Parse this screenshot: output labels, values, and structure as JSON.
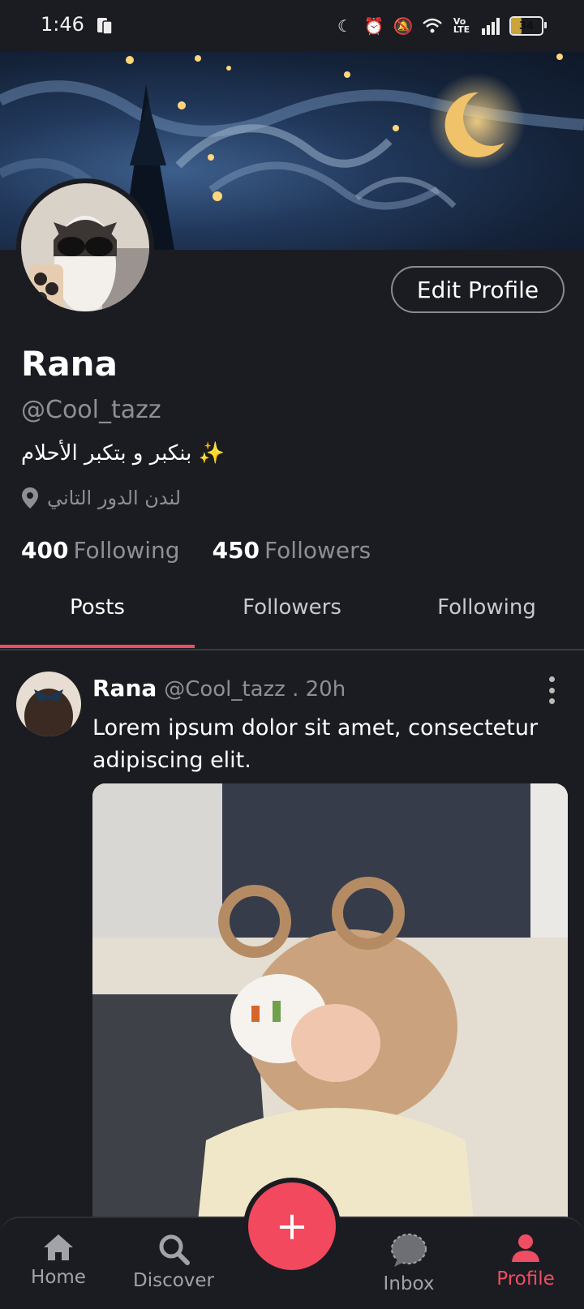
{
  "status_bar": {
    "time": "1:46",
    "battery": "34"
  },
  "profile": {
    "edit_label": "Edit Profile",
    "name": "Rana",
    "handle": "@Cool_tazz",
    "bio": "بنكبر و بتكبر الأحلام ✨",
    "location": "لندن الدور التاني",
    "following_count": "400",
    "following_label": "Following",
    "followers_count": "450",
    "followers_label": "Followers"
  },
  "tabs": [
    {
      "label": "Posts"
    },
    {
      "label": "Followers"
    },
    {
      "label": "Following"
    }
  ],
  "post": {
    "author": "Rana",
    "meta": "@Cool_tazz . 20h",
    "text": "Lorem ipsum dolor sit amet, consectetur adipiscing elit."
  },
  "nav": {
    "home": "Home",
    "discover": "Discover",
    "inbox": "Inbox",
    "profile": "Profile",
    "fab_symbol": "+"
  },
  "colors": {
    "accent": "#ef4d63",
    "background": "#1b1c21",
    "muted": "#8e8f94"
  }
}
